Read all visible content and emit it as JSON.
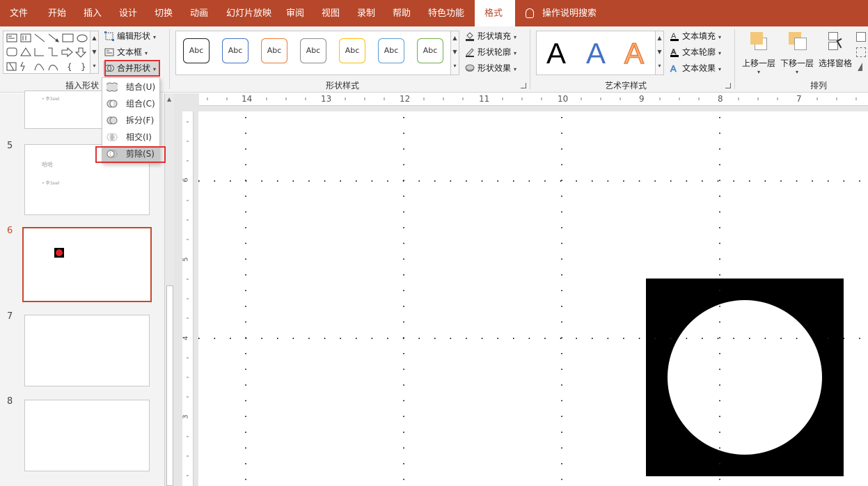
{
  "tabs": [
    "文件",
    "开始",
    "插入",
    "设计",
    "切换",
    "动画",
    "幻灯片放映",
    "审阅",
    "视图",
    "录制",
    "帮助",
    "特色功能",
    "格式"
  ],
  "active_tab": "格式",
  "tell_me": "操作说明搜索",
  "ribbon": {
    "insert_shapes": {
      "label": "插入形状",
      "edit_shape": "编辑形状",
      "text_box": "文本框",
      "merge_shapes": "合并形状"
    },
    "shape_styles": {
      "label": "形状样式",
      "style_samples": [
        "Abc",
        "Abc",
        "Abc",
        "Abc",
        "Abc",
        "Abc",
        "Abc"
      ],
      "style_colors": [
        "#222222",
        "#4472c4",
        "#ed7d31",
        "#8c8c8c",
        "#ffc000",
        "#5b9bd5",
        "#70ad47"
      ],
      "shape_fill": "形状填充",
      "shape_outline": "形状轮廓",
      "shape_effects": "形状效果"
    },
    "wordart_styles": {
      "label": "艺术字样式",
      "samples": [
        "A",
        "A",
        "A"
      ],
      "text_fill": "文本填充",
      "text_outline": "文本轮廓",
      "text_effects": "文本效果"
    },
    "arrange": {
      "label": "排列",
      "bring_forward": "上移一层",
      "send_backward": "下移一层",
      "selection_pane": "选择窗格"
    }
  },
  "merge_menu": {
    "items": [
      "结合(U)",
      "组合(C)",
      "拆分(F)",
      "相交(I)",
      "剪除(S)"
    ],
    "selected": "剪除(S)"
  },
  "slides": {
    "numbers": [
      "5",
      "6",
      "7",
      "8"
    ],
    "active": "6",
    "slide4_text": "• 李3awl",
    "slide5_title": "哈哈",
    "slide5_text": "• 李3awl"
  },
  "ruler": {
    "horizontal": [
      "14",
      "13",
      "12",
      "11",
      "10",
      "9",
      "8",
      "7"
    ],
    "vertical": [
      "6",
      "5",
      "4",
      "3"
    ]
  },
  "colors": {
    "accent": "#b7472a",
    "highlight": "#e03030",
    "active_thumb_border": "#c9472b"
  }
}
